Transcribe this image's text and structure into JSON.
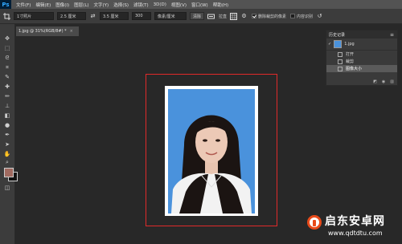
{
  "app": {
    "logo": "Ps",
    "menu": [
      "文件(F)",
      "编辑(E)",
      "图像(I)",
      "图层(L)",
      "文字(Y)",
      "选择(S)",
      "滤镜(T)",
      "3D(D)",
      "视图(V)",
      "窗口(W)",
      "帮助(H)"
    ]
  },
  "options": {
    "tool_icon": "crop-icon",
    "preset": "1寸照片",
    "width": "2.5 厘米",
    "height": "3.5 厘米",
    "resolution": "300",
    "unit": "像素/厘米",
    "clear": "清除",
    "straighten": "拉直",
    "delete_cropped": "删除裁剪的像素",
    "content_aware": "内容识别"
  },
  "document": {
    "tab_title": "1.jpg @ 31%(RGB/8#) *",
    "close": "×"
  },
  "history_panel": {
    "title": "历史记录",
    "snapshot": "1.jpg",
    "items": [
      "打开",
      "裁剪",
      "图像大小"
    ],
    "active_index": 2
  },
  "colors": {
    "foreground": "#a06a60",
    "background": "#111111",
    "photo_bg": "#4a92dc",
    "highlight": "#e02a2a"
  },
  "watermark": {
    "name": "启东安卓网",
    "url": "www.qdtdtu.com"
  }
}
